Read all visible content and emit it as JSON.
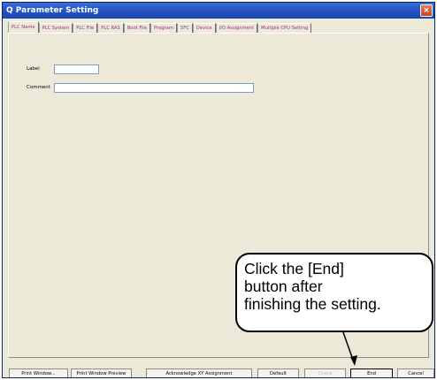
{
  "window": {
    "title": "Q Parameter Setting",
    "close_glyph": "×"
  },
  "tabs": [
    {
      "label": "PLC Name",
      "active": true
    },
    {
      "label": "PLC System"
    },
    {
      "label": "PLC File"
    },
    {
      "label": "PLC RAS"
    },
    {
      "label": "Boot File"
    },
    {
      "label": "Program"
    },
    {
      "label": "SFC"
    },
    {
      "label": "Device"
    },
    {
      "label": "I/O Assignment"
    },
    {
      "label": "Multiple CPU Setting"
    }
  ],
  "form": {
    "label_caption": "Label",
    "label_value": "",
    "comment_caption": "Comment",
    "comment_value": ""
  },
  "buttons": {
    "print_window": "Print Window...",
    "print_preview": "Print Window Preview",
    "acknowledge": "Acknowledge XY Assignment",
    "default": "Default",
    "check": "Check",
    "end": "End",
    "cancel": "Cancel"
  },
  "callout": {
    "line1": "Click the [End]",
    "line2": "button after",
    "line3": "finishing the setting."
  },
  "colors": {
    "tab_text": "#a32a86",
    "titlebar": "#2456c4",
    "window_bg": "#ece9d8"
  }
}
